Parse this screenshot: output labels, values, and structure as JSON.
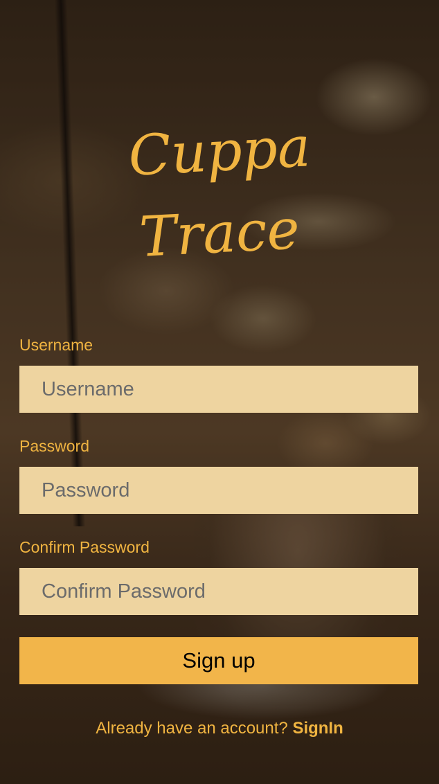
{
  "app": {
    "logo_line1": "Cuppa",
    "logo_line2": "Trace"
  },
  "form": {
    "username": {
      "label": "Username",
      "placeholder": "Username",
      "value": ""
    },
    "password": {
      "label": "Password",
      "placeholder": "Password",
      "value": ""
    },
    "confirm_password": {
      "label": "Confirm Password",
      "placeholder": "Confirm Password",
      "value": ""
    },
    "submit_label": "Sign up"
  },
  "footer": {
    "prompt": "Already have an account?",
    "signin_label": "SignIn"
  },
  "colors": {
    "accent": "#f0b441",
    "input_background": "#eed4a0",
    "button_background": "#f2b54a"
  },
  "background": {
    "icon": "coffee-cafe-photo"
  }
}
